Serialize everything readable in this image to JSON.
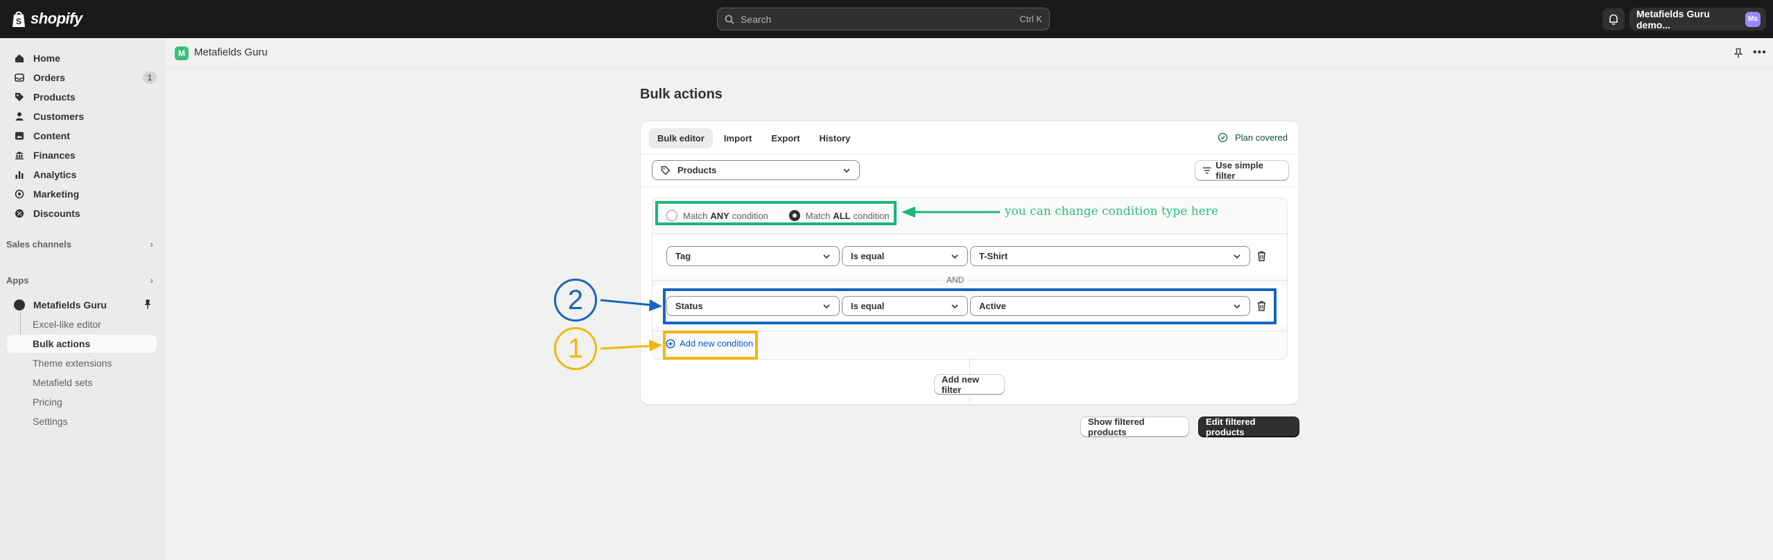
{
  "topbar": {
    "logo_text": "shopify",
    "search_placeholder": "Search",
    "search_shortcut": "Ctrl K",
    "store_name": "Metafields Guru demo...",
    "avatar_initials": "Ms"
  },
  "sidebar": {
    "items": [
      {
        "label": "Home",
        "icon": "home-icon"
      },
      {
        "label": "Orders",
        "icon": "orders-icon",
        "badge": "1"
      },
      {
        "label": "Products",
        "icon": "tag-icon"
      },
      {
        "label": "Customers",
        "icon": "person-icon"
      },
      {
        "label": "Content",
        "icon": "content-icon"
      },
      {
        "label": "Finances",
        "icon": "bank-icon"
      },
      {
        "label": "Analytics",
        "icon": "chart-icon"
      },
      {
        "label": "Marketing",
        "icon": "target-icon"
      },
      {
        "label": "Discounts",
        "icon": "discount-icon"
      }
    ],
    "sales_channels": "Sales channels",
    "apps": "Apps",
    "app_name": "Metafields Guru",
    "sub_items": [
      {
        "label": "Excel-like editor"
      },
      {
        "label": "Bulk actions"
      },
      {
        "label": "Theme extensions"
      },
      {
        "label": "Metafield sets"
      },
      {
        "label": "Pricing"
      },
      {
        "label": "Settings"
      }
    ]
  },
  "app_header": {
    "logo_letter": "M",
    "title": "Metafields Guru"
  },
  "page": {
    "title": "Bulk actions",
    "tabs": [
      {
        "label": "Bulk editor"
      },
      {
        "label": "Import"
      },
      {
        "label": "Export"
      },
      {
        "label": "History"
      }
    ],
    "plan_status": "Plan covered",
    "resource_select": "Products",
    "simple_filter_button": "Use simple filter",
    "match_any_prefix": "Match",
    "match_any_bold": "ANY",
    "match_any_suffix": "condition",
    "match_all_prefix": "Match",
    "match_all_bold": "ALL",
    "match_all_suffix": "condition",
    "conditions": [
      {
        "field": "Tag",
        "operator": "Is equal",
        "value": "T-Shirt"
      },
      {
        "field": "Status",
        "operator": "Is equal",
        "value": "Active"
      }
    ],
    "and_label": "AND",
    "add_condition": "Add new condition",
    "add_filter": "Add new filter",
    "show_filtered": "Show filtered products",
    "edit_filtered": "Edit filtered products"
  },
  "annotations": {
    "note": "you can change condition type here",
    "step_1": "1",
    "step_2": "2"
  },
  "colors": {
    "annotation_green": "#1bb57a",
    "annotation_blue": "#1565c0",
    "annotation_yellow": "#f2b705",
    "link_blue": "#005bd3"
  }
}
